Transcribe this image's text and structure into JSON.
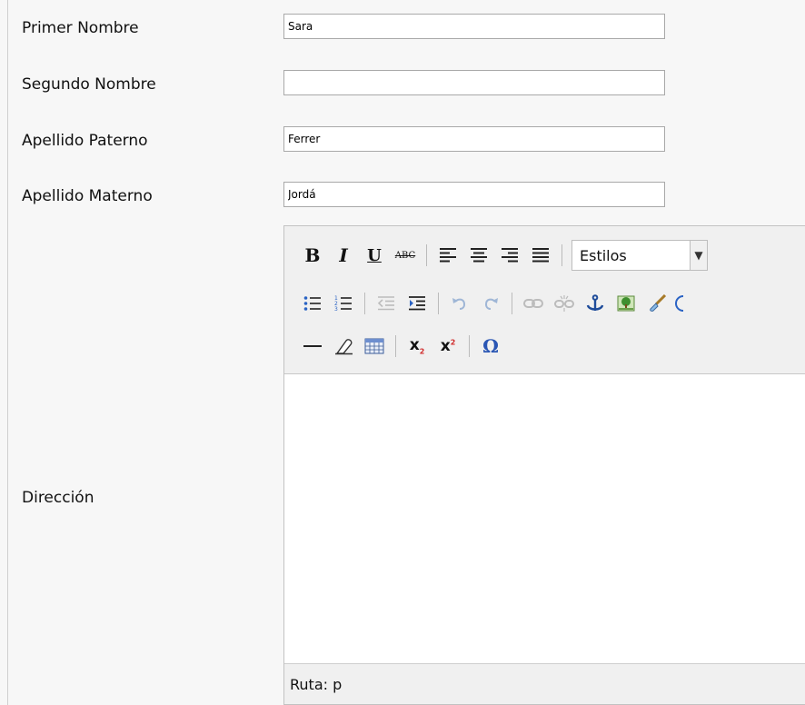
{
  "form": {
    "fields": [
      {
        "label": "Primer Nombre",
        "value": "Sara"
      },
      {
        "label": "Segundo Nombre",
        "value": ""
      },
      {
        "label": "Apellido Paterno",
        "value": "Ferrer"
      },
      {
        "label": "Apellido Materno",
        "value": "Jordá"
      }
    ],
    "address_label": "Dirección"
  },
  "editor": {
    "styles_label": "Estilos",
    "status_path": "Ruta: p",
    "icons": {
      "bold": "B",
      "italic": "I",
      "underline": "U",
      "strikethrough": "ABC",
      "subscript": "x",
      "superscript": "x",
      "special_char": "Ω"
    }
  }
}
